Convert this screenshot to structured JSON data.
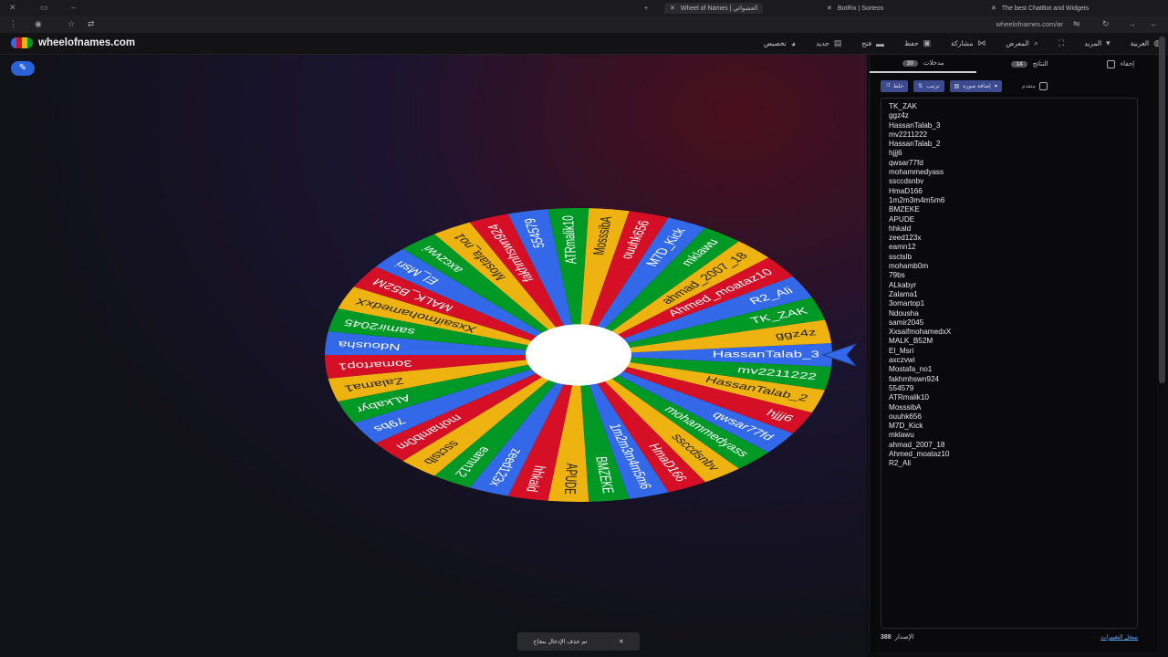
{
  "browser": {
    "tabs": [
      {
        "label": "The best ChatBot and Widgets"
      },
      {
        "label": "BotRix | Sorteos"
      },
      {
        "label": "Wheel of Names | العشوائي"
      }
    ],
    "url": "wheelofnames.com/ar"
  },
  "app": {
    "site_name": "wheelofnames.com",
    "menu": [
      {
        "label": "العربية",
        "icon": "globe-icon"
      },
      {
        "label": "المزيد",
        "icon": "chevron-down-icon"
      },
      {
        "label": "",
        "icon": "fullscreen-icon"
      },
      {
        "label": "المعرض",
        "icon": "search-icon"
      },
      {
        "label": "مشاركة",
        "icon": "share-icon"
      },
      {
        "label": "حفظ",
        "icon": "save-icon"
      },
      {
        "label": "فتح",
        "icon": "folder-icon"
      },
      {
        "label": "جديد",
        "icon": "file-icon"
      },
      {
        "label": "تخصيص",
        "icon": "palette-icon"
      }
    ]
  },
  "colors": {
    "blue": "#3369e8",
    "red": "#d50f25",
    "yellow": "#eeb211",
    "green": "#009925",
    "accent": "#2b62d6"
  },
  "wheel": {
    "names": [
      "HassanTalab_3",
      "mv2211222",
      "HassanTalab_2",
      "hjjj6",
      "qwsar77fd",
      "mohammedyass",
      "ssccdsnbv",
      "HmaD166",
      "1m2m3m4m5m6",
      "BMZEKE",
      "APUDE",
      "hhkald",
      "zeed123x",
      "eamn12",
      "ssctslb",
      "mohamb0m",
      "79bs",
      "ALkabyr",
      "Zalama1",
      "3omartop1",
      "Ndousha",
      "samir2045",
      "XxsaifmohamedxX",
      "MALK_B52M",
      "El_Msri",
      "axczvwi",
      "Mostafa_no1",
      "fakhmhswn924",
      "554579",
      "ATRmalik10",
      "MosssibA",
      "ouuhk656",
      "M7D_Kick",
      "mklawu",
      "ahmad_2007_18",
      "Ahmed_moataz10",
      "R2_Ali",
      "TK_ZAK",
      "ggz4z"
    ]
  },
  "panel": {
    "hide_label": "إخفاء",
    "tab_results": "النتائج",
    "results_count": "14",
    "tab_entries": "مدخلات",
    "entries_count": "39",
    "shuffle_label": "خلط",
    "sort_label": "ترتيب",
    "add_image_label": "إضافة صورة",
    "advanced_label": "متقدم",
    "entries": [
      "TK_ZAK",
      "ggz4z",
      "HassanTalab_3",
      "mv2211222",
      "HassanTalab_2",
      "hjjj6",
      "qwsar77fd",
      "mohammedyass",
      "ssccdsnbv",
      "HmaD166",
      "1m2m3m4m5m6",
      "BMZEKE",
      "APUDE",
      "hhkald",
      "zeed123x",
      "eamn12",
      "ssctslb",
      "mohamb0m",
      "79bs",
      "ALkabyr",
      "Zalama1",
      "3omartop1",
      "Ndousha",
      "samir2045",
      "XxsaifmohamedxX",
      "MALK_B52M",
      "El_Msri",
      "axczvwi",
      "Mostafa_no1",
      "fakhmhswn924",
      "554579",
      "ATRmalik10",
      "MosssibA",
      "ouuhk656",
      "M7D_Kick",
      "mklawu",
      "ahmad_2007_18",
      "Ahmed_moataz10",
      "R2_Ali"
    ],
    "version_label": "الإصدار",
    "version": "388",
    "changelog_link": "سجل التغييرات"
  },
  "toast": {
    "text": "تم حذف الإدخال بنجاح"
  }
}
